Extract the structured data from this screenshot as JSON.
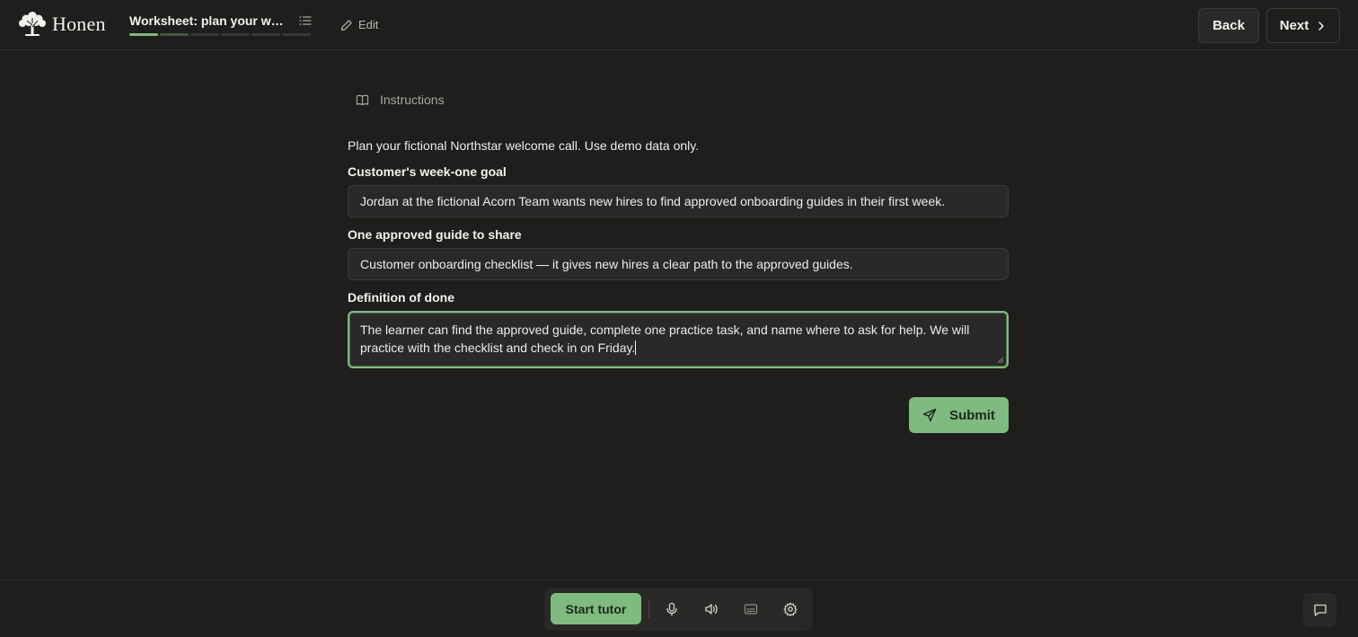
{
  "app": {
    "name": "Honen"
  },
  "header": {
    "worksheet_title": "Worksheet: plan your welcome call",
    "progress": {
      "completed_steps": 1,
      "total_steps": 6
    },
    "edit_label": "Edit",
    "back_label": "Back",
    "next_label": "Next"
  },
  "main": {
    "instructions_label": "Instructions",
    "prompt": "Plan your fictional Northstar welcome call. Use demo data only.",
    "fields": [
      {
        "label": "Customer's week-one goal",
        "value": "Jordan at the fictional Acorn Team wants new hires to find approved onboarding guides in their first week."
      },
      {
        "label": "One approved guide to share",
        "value": "Customer onboarding checklist — it gives new hires a clear path to the approved guides."
      },
      {
        "label": "Definition of done",
        "value": "The learner can find the approved guide, complete one practice task, and name where to ask for help. We will practice with the checklist and check in on Friday."
      }
    ],
    "submit_label": "Submit"
  },
  "toolbar": {
    "start_tutor_label": "Start tutor",
    "icons": [
      "microphone-icon",
      "speaker-icon",
      "captions-icon",
      "settings-icon"
    ]
  },
  "colors": {
    "background": "#1f1e1c",
    "accent": "#7fba80",
    "field_background": "#2a2927"
  }
}
